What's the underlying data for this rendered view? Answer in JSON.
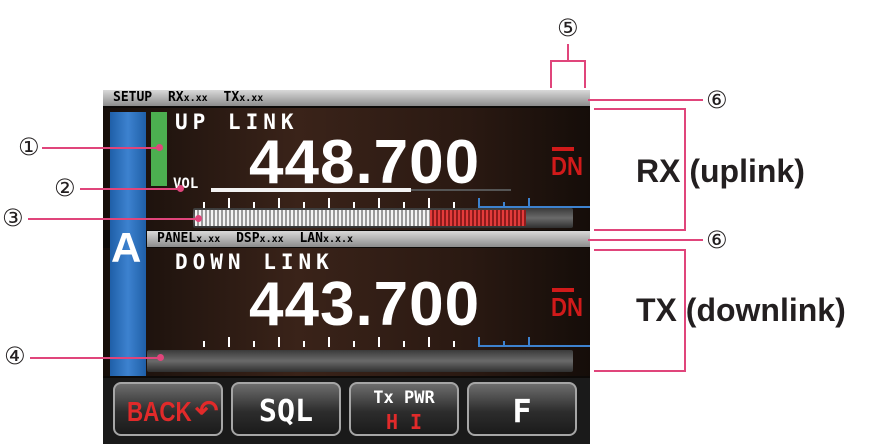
{
  "callouts": {
    "c1": "①",
    "c2": "②",
    "c3": "③",
    "c4": "④",
    "c5": "⑤",
    "c6a": "⑥",
    "c6b": "⑥"
  },
  "labels": {
    "rx": "RX (uplink)",
    "tx": "TX (downlink)"
  },
  "screen": {
    "top_status": {
      "setup": "SETUP",
      "rx": "RX",
      "rx_ver": "x.xx",
      "tx": "TX",
      "tx_ver": "x.xx"
    },
    "mid_status": {
      "panel": "PANEL",
      "panel_ver": "x.xx",
      "dsp": "DSP",
      "dsp_ver": "x.xx",
      "lan": "LAN",
      "lan_ver": "x.x.x"
    },
    "band_letter": "A",
    "uplink": {
      "label": "UP LINK",
      "frequency": "448.700",
      "mode": "DN",
      "vol_label": "VOL"
    },
    "downlink": {
      "label": "DOWN LINK",
      "frequency": "443.700",
      "mode": "DN"
    },
    "buttons": {
      "back": "BACK",
      "sql": "SQL",
      "txpwr_top": "Tx PWR",
      "txpwr_bottom": "H I",
      "f": "F"
    }
  },
  "colors": {
    "leader_line": "#e0457b",
    "mode_red": "#d11a1a",
    "band_blue": "#2f72bf",
    "squelch_green": "#4caf50"
  }
}
